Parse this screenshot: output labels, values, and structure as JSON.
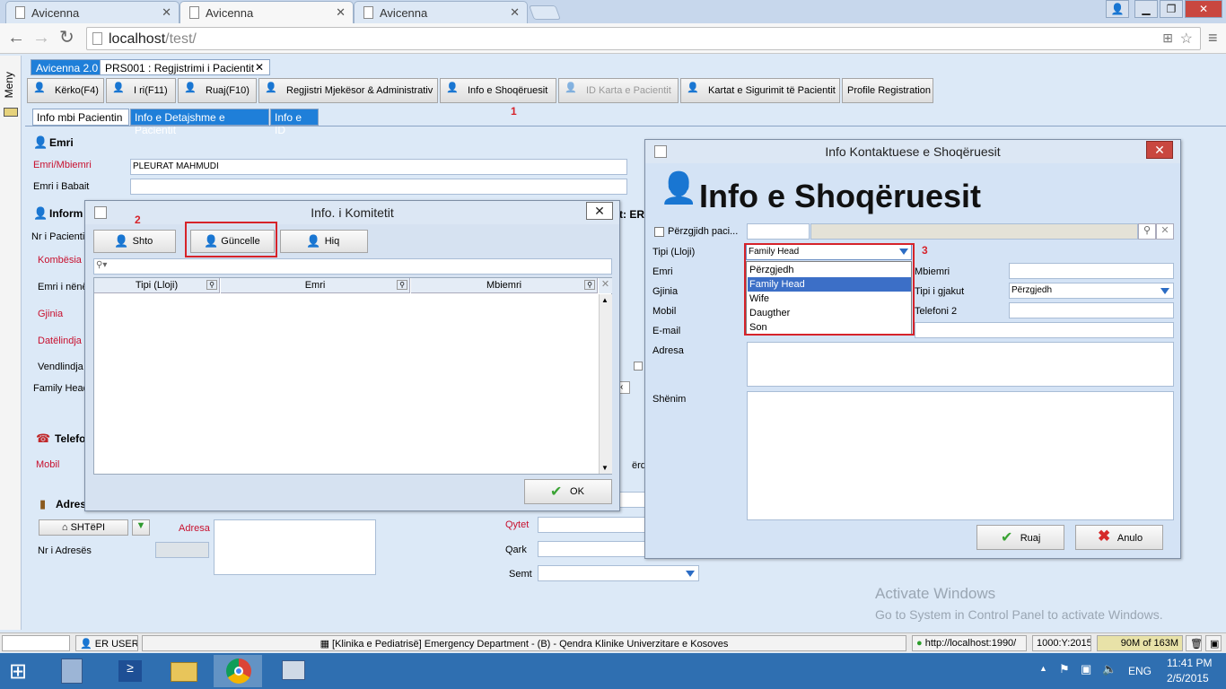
{
  "browser": {
    "tabs": [
      {
        "title": "Avicenna"
      },
      {
        "title": "Avicenna"
      },
      {
        "title": "Avicenna"
      }
    ],
    "url_host": "localhost",
    "url_path": "/test/"
  },
  "app": {
    "sidebar_label": "Meny",
    "breadcrumb": {
      "root": "Avicenna 2.0",
      "page": "PRS001 : Regjistrimi i Pacientit",
      "close": "✕"
    },
    "toolbar": {
      "search": "Kërko(F4)",
      "new": "I ri(F11)",
      "save": "Ruaj(F10)",
      "registry": "Regjistri Mjekësor & Administrativ",
      "companion": "Info e Shoqëruesit",
      "id_card": "ID Karta e Pacientit",
      "insurance": "Kartat e Sigurimit të Pacientit",
      "profile": "Profile Registration"
    },
    "subtabs": [
      "Info mbi Pacientin",
      "Info e Detajshme e Pacientit",
      "Info e ID"
    ],
    "markers": {
      "one": "1",
      "two": "2",
      "three": "3"
    }
  },
  "patient_form": {
    "name_section": "Emri",
    "name_label": "Emri/Mbiemri",
    "name_value": "PLEURAT MAHMUDI",
    "father_label": "Emri i Babait",
    "info_section": "Inform",
    "patient_no_label": "Nr i Pacientit",
    "nationality_label": "Kombësia",
    "mother_label": "Emri i nënë",
    "gender_label": "Gjinia",
    "birthdate_label": "Datëlindja",
    "birthplace_label": "Vendlindja",
    "family_head_label": "Family Head",
    "er_fragment": "t: ER",
    "phone_section": "Telefo",
    "mobile_label": "Mobil",
    "perdo_fragment": "ërdo",
    "address_section": "Adres",
    "home_button": "SHTëPI",
    "address_label": "Adresa",
    "address_no_label": "Nr i Adresës",
    "city_label": "Qytet",
    "district_label": "Qark",
    "village_label": "Semt"
  },
  "committee_dialog": {
    "title": "Info. i Komitetit",
    "close": "✕",
    "add": "Shto",
    "update": "Güncelle",
    "remove": "Hiq",
    "search_icon": "magnifier-icon",
    "columns": [
      "Tipi (Lloji)",
      "Emri",
      "Mbiemri"
    ],
    "ok": "OK"
  },
  "companion_dialog": {
    "title": "Info Kontaktuese e Shoqëruesit",
    "close": "✕",
    "heading": "Info e Shoqëruesit",
    "select_patient_label": "Përzgjidh paci...",
    "type_label": "Tipi (Lloji)",
    "type_value": "Family Head",
    "type_options": [
      "Përzgjedh",
      "Family Head",
      "Wife",
      "Daugther",
      "Son"
    ],
    "type_selected_index": 1,
    "first_name_label": "Emri",
    "last_name_label": "Mbiemri",
    "gender_label": "Gjinia",
    "blood_type_label": "Tipi i gjakut",
    "blood_type_value": "Përzgjedh",
    "mobile_label": "Mobil",
    "phone2_label": "Telefoni 2",
    "email_label": "E-mail",
    "address_label": "Adresa",
    "note_label": "Shënim",
    "save": "Ruaj",
    "cancel": "Anulo"
  },
  "watermark": {
    "line1": "Activate Windows",
    "line2": "Go to System in Control Panel to activate Windows."
  },
  "statusbar": {
    "user": "ER USER",
    "department": "[Klinika e Pediatrisë] Emergency Department - (B) - Qendra Klinike Univerzitare e Kosoves",
    "server": "http://localhost:1990/",
    "coords": "1000:Y:2015",
    "memory": "90M of 163M"
  },
  "taskbar": {
    "language": "ENG",
    "time": "11:41 PM",
    "date": "2/5/2015"
  },
  "colors": {
    "accent_blue": "#1f7fd9",
    "required_red": "#c8102e",
    "highlight_red": "#d6232a",
    "selection_blue": "#3c6fc7"
  }
}
